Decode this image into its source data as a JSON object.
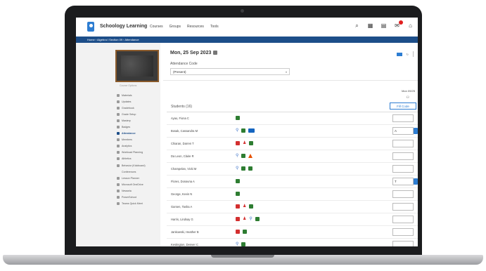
{
  "app": {
    "brand": "Schoology Learning",
    "nav": [
      "Courses",
      "Groups",
      "Resources",
      "Tools"
    ],
    "breadcrumb": "Home  ›  Algebra I Section 09  ›  Attendance"
  },
  "sidebar": {
    "course_prefs": "Course Options",
    "items": [
      {
        "label": "Materials",
        "active": false
      },
      {
        "label": "Updates",
        "active": false
      },
      {
        "label": "Gradebook",
        "active": false
      },
      {
        "label": "Grade Setup",
        "active": false
      },
      {
        "label": "Mastery",
        "active": false
      },
      {
        "label": "Badges",
        "active": false
      },
      {
        "label": "Attendance",
        "active": true
      },
      {
        "label": "Members",
        "active": false
      },
      {
        "label": "Analytics",
        "active": false
      },
      {
        "label": "Workload Planning",
        "active": false
      },
      {
        "label": "Athletics",
        "active": false
      },
      {
        "label": "Behavior (Kickboard)",
        "active": false
      },
      {
        "label": "Conferences",
        "active": false
      },
      {
        "label": "Lesson Planner",
        "active": false
      },
      {
        "label": "Microsoft OneDrive",
        "active": false
      },
      {
        "label": "Newsela",
        "active": false
      },
      {
        "label": "PowerSchool",
        "active": false
      },
      {
        "label": "Teams Quick Meet",
        "active": false
      }
    ]
  },
  "main": {
    "date": "Mon, 25 Sep 2023",
    "attendance_code_label": "Attendance Code",
    "attendance_code_value": "(Present)",
    "day_header": "Mon 09/25",
    "students_label": "Students (16)",
    "fill_code_button": "Fill Code",
    "students": [
      {
        "name": "Ayao, Fiona C",
        "icons": [
          "g"
        ],
        "code": ""
      },
      {
        "name": "Bosak, Cassandra M",
        "icons": [
          "pin",
          "g",
          "bd"
        ],
        "code": "A"
      },
      {
        "name": "Chiaran, Darren T",
        "icons": [
          "r",
          "person",
          "g"
        ],
        "code": ""
      },
      {
        "name": "Da Leon, Claire R",
        "icons": [
          "pin",
          "g",
          "tri"
        ],
        "code": ""
      },
      {
        "name": "Champelan, Vicki M",
        "icons": [
          "pin",
          "g",
          "g"
        ],
        "code": ""
      },
      {
        "name": "Flores, Donavna A",
        "icons": [
          "g"
        ],
        "code": "T"
      },
      {
        "name": "George, Kevin N",
        "icons": [
          "g"
        ],
        "code": ""
      },
      {
        "name": "Garsen, Tasha A",
        "icons": [
          "r",
          "person",
          "g"
        ],
        "code": ""
      },
      {
        "name": "Harris, Lindsay G",
        "icons": [
          "r",
          "person",
          "pin",
          "g"
        ],
        "code": ""
      },
      {
        "name": "Jankowski, Heather B",
        "icons": [
          "r",
          "g"
        ],
        "code": ""
      },
      {
        "name": "Kestington, Denver C",
        "icons": [
          "pin",
          "g"
        ],
        "code": ""
      }
    ]
  },
  "colors": {
    "accent": "#2d7dd2",
    "crumb_bar": "#1d4e89"
  }
}
